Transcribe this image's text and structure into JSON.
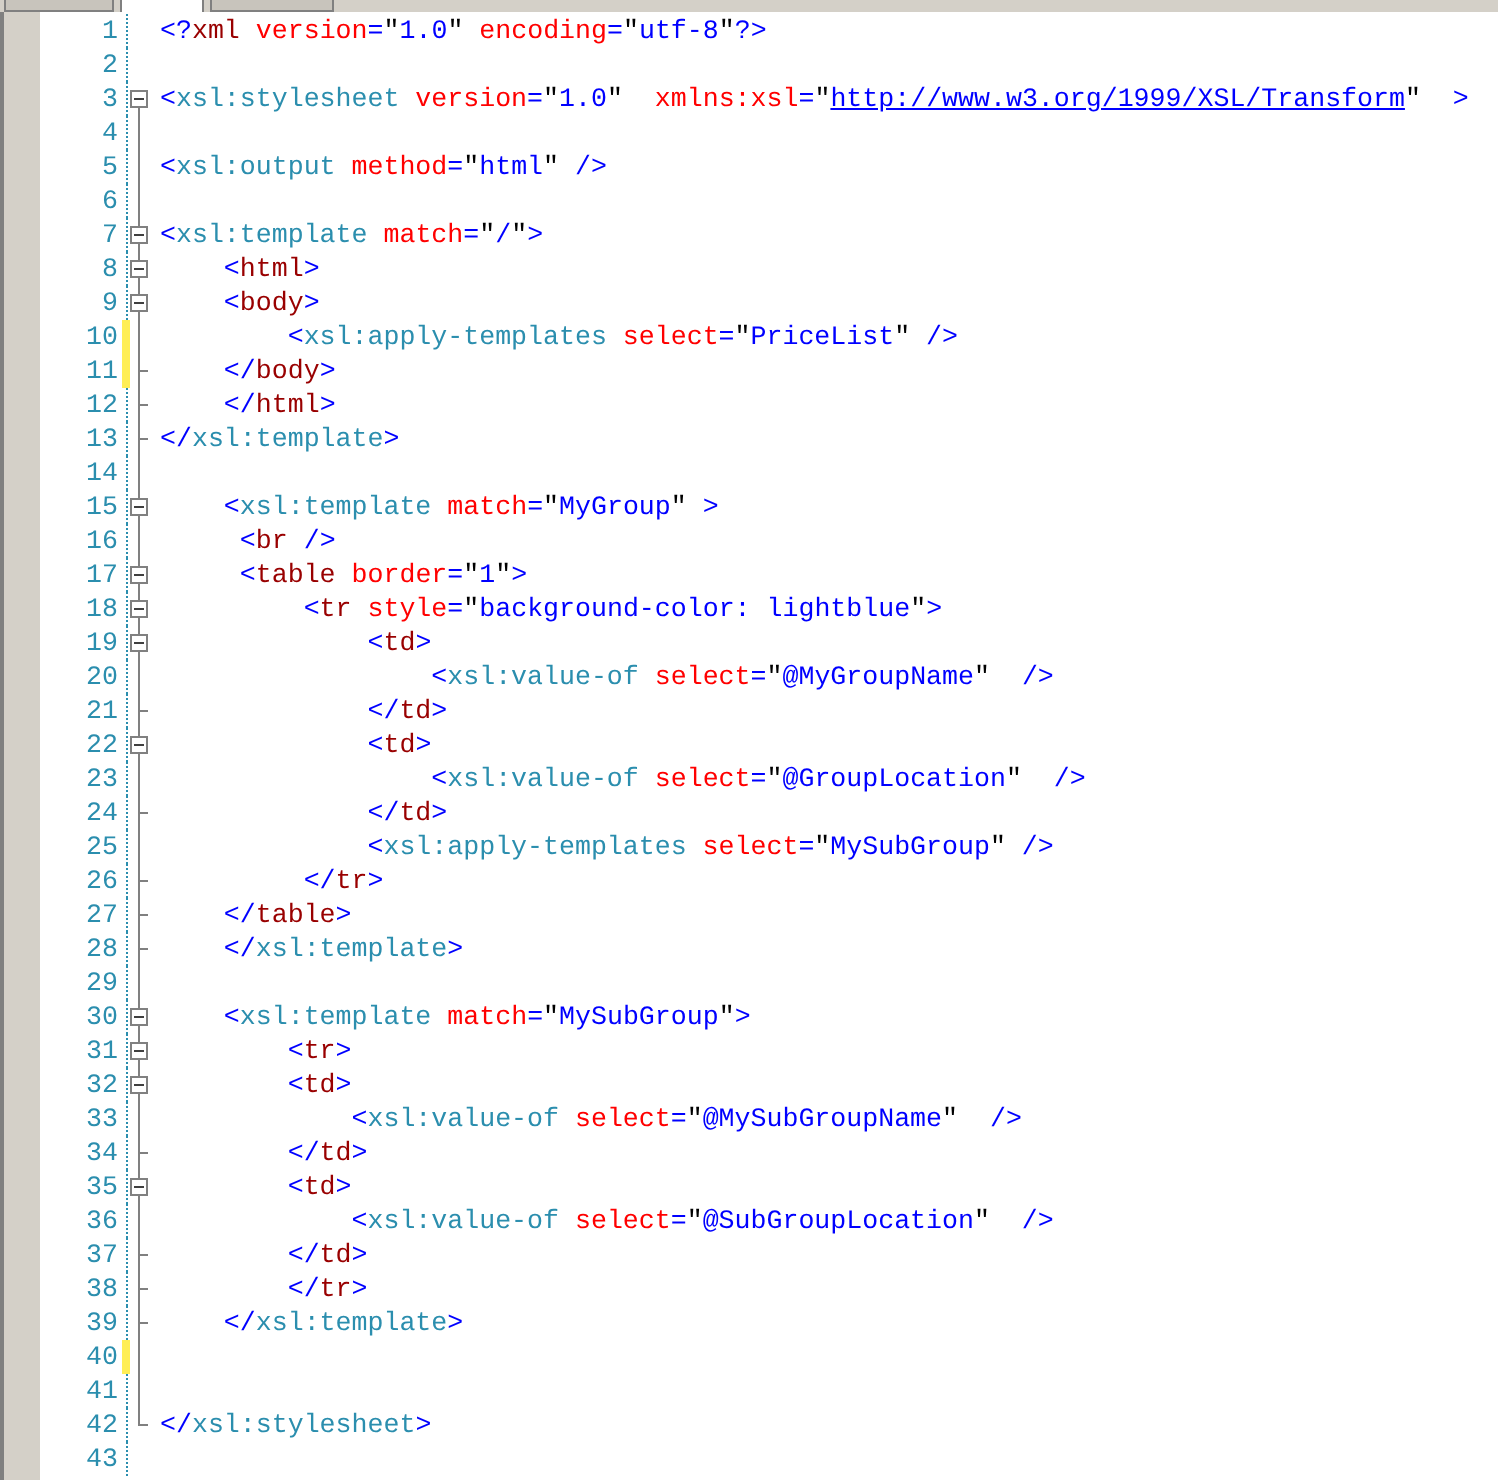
{
  "tabs": [
    {
      "selected": false
    },
    {
      "selected": true
    },
    {
      "selected": false
    }
  ],
  "lines": [
    {
      "number": "1",
      "changed": false,
      "kind": "plain",
      "tokens": [
        {
          "kind": "punct",
          "text": "<?"
        },
        {
          "kind": "html-name",
          "text": "xml"
        },
        {
          "kind": "attribute",
          "text": " version"
        },
        {
          "kind": "punct",
          "text": "="
        },
        {
          "kind": "quote",
          "text": "\""
        },
        {
          "kind": "value",
          "text": "1.0"
        },
        {
          "kind": "quote",
          "text": "\""
        },
        {
          "kind": "attribute",
          "text": " encoding"
        },
        {
          "kind": "punct",
          "text": "="
        },
        {
          "kind": "quote",
          "text": "\""
        },
        {
          "kind": "value",
          "text": "utf-8"
        },
        {
          "kind": "quote",
          "text": "\""
        },
        {
          "kind": "punct",
          "text": "?>"
        }
      ]
    },
    {
      "number": "2",
      "changed": false,
      "kind": "plain"
    },
    {
      "number": "3",
      "changed": false,
      "kind": "fold-start",
      "tokens": [
        {
          "kind": "punct",
          "text": "<"
        },
        {
          "kind": "xsl-name",
          "text": "xsl:stylesheet"
        },
        {
          "kind": "attribute",
          "text": " version"
        },
        {
          "kind": "punct",
          "text": "="
        },
        {
          "kind": "quote",
          "text": "\""
        },
        {
          "kind": "value",
          "text": "1.0"
        },
        {
          "kind": "quote",
          "text": "\""
        },
        {
          "kind": "attribute",
          "text": "  xmlns:xsl"
        },
        {
          "kind": "punct",
          "text": "="
        },
        {
          "kind": "quote",
          "text": "\""
        },
        {
          "kind": "url",
          "text": "http://www.w3.org/1999/XSL/Transform"
        },
        {
          "kind": "quote",
          "text": "\""
        },
        {
          "kind": "punct",
          "text": "  >"
        }
      ]
    },
    {
      "number": "4",
      "changed": false,
      "kind": "plain"
    },
    {
      "number": "5",
      "changed": false,
      "kind": "plain",
      "tokens": [
        {
          "kind": "punct",
          "text": "<"
        },
        {
          "kind": "xsl-name",
          "text": "xsl:output"
        },
        {
          "kind": "attribute",
          "text": " method"
        },
        {
          "kind": "punct",
          "text": "="
        },
        {
          "kind": "quote",
          "text": "\""
        },
        {
          "kind": "value",
          "text": "html"
        },
        {
          "kind": "quote",
          "text": "\""
        },
        {
          "kind": "punct",
          "text": " />"
        }
      ]
    },
    {
      "number": "6",
      "changed": false,
      "kind": "plain"
    },
    {
      "number": "7",
      "changed": false,
      "kind": "fold-start",
      "tokens": [
        {
          "kind": "punct",
          "text": "<"
        },
        {
          "kind": "xsl-name",
          "text": "xsl:template"
        },
        {
          "kind": "attribute",
          "text": " match"
        },
        {
          "kind": "punct",
          "text": "="
        },
        {
          "kind": "quote",
          "text": "\""
        },
        {
          "kind": "value",
          "text": "/"
        },
        {
          "kind": "quote",
          "text": "\""
        },
        {
          "kind": "punct",
          "text": ">"
        }
      ]
    },
    {
      "number": "8",
      "changed": false,
      "kind": "fold-start",
      "tokens": [
        {
          "kind": "punct",
          "text": "    <"
        },
        {
          "kind": "html-name",
          "text": "html"
        },
        {
          "kind": "punct",
          "text": ">"
        }
      ]
    },
    {
      "number": "9",
      "changed": false,
      "kind": "fold-start",
      "tokens": [
        {
          "kind": "punct",
          "text": "    <"
        },
        {
          "kind": "html-name",
          "text": "body"
        },
        {
          "kind": "punct",
          "text": ">"
        }
      ]
    },
    {
      "number": "10",
      "changed": true,
      "kind": "plain",
      "tokens": [
        {
          "kind": "punct",
          "text": "        <"
        },
        {
          "kind": "xsl-name",
          "text": "xsl:apply-templates"
        },
        {
          "kind": "attribute",
          "text": " select"
        },
        {
          "kind": "punct",
          "text": "="
        },
        {
          "kind": "quote",
          "text": "\""
        },
        {
          "kind": "value",
          "text": "PriceList"
        },
        {
          "kind": "quote",
          "text": "\""
        },
        {
          "kind": "punct",
          "text": " />"
        }
      ]
    },
    {
      "number": "11",
      "changed": true,
      "kind": "fold-end",
      "tokens": [
        {
          "kind": "punct",
          "text": "    </"
        },
        {
          "kind": "html-name",
          "text": "body"
        },
        {
          "kind": "punct",
          "text": ">"
        }
      ]
    },
    {
      "number": "12",
      "changed": false,
      "kind": "fold-end",
      "tokens": [
        {
          "kind": "punct",
          "text": "    </"
        },
        {
          "kind": "html-name",
          "text": "html"
        },
        {
          "kind": "punct",
          "text": ">"
        }
      ]
    },
    {
      "number": "13",
      "changed": false,
      "kind": "fold-end",
      "tokens": [
        {
          "kind": "punct",
          "text": "</"
        },
        {
          "kind": "xsl-name",
          "text": "xsl:template"
        },
        {
          "kind": "punct",
          "text": ">"
        }
      ]
    },
    {
      "number": "14",
      "changed": false,
      "kind": "plain"
    },
    {
      "number": "15",
      "changed": false,
      "kind": "fold-start",
      "tokens": [
        {
          "kind": "punct",
          "text": "    <"
        },
        {
          "kind": "xsl-name",
          "text": "xsl:template"
        },
        {
          "kind": "attribute",
          "text": " match"
        },
        {
          "kind": "punct",
          "text": "="
        },
        {
          "kind": "quote",
          "text": "\""
        },
        {
          "kind": "value",
          "text": "MyGroup"
        },
        {
          "kind": "quote",
          "text": "\""
        },
        {
          "kind": "punct",
          "text": " >"
        }
      ]
    },
    {
      "number": "16",
      "changed": false,
      "kind": "plain",
      "tokens": [
        {
          "kind": "punct",
          "text": "     <"
        },
        {
          "kind": "html-name",
          "text": "br"
        },
        {
          "kind": "punct",
          "text": " />"
        }
      ]
    },
    {
      "number": "17",
      "changed": false,
      "kind": "fold-start",
      "tokens": [
        {
          "kind": "punct",
          "text": "     <"
        },
        {
          "kind": "html-name",
          "text": "table"
        },
        {
          "kind": "attribute",
          "text": " border"
        },
        {
          "kind": "punct",
          "text": "="
        },
        {
          "kind": "quote",
          "text": "\""
        },
        {
          "kind": "value",
          "text": "1"
        },
        {
          "kind": "quote",
          "text": "\""
        },
        {
          "kind": "punct",
          "text": ">"
        }
      ]
    },
    {
      "number": "18",
      "changed": false,
      "kind": "fold-start",
      "tokens": [
        {
          "kind": "punct",
          "text": "         <"
        },
        {
          "kind": "html-name",
          "text": "tr"
        },
        {
          "kind": "attribute",
          "text": " style"
        },
        {
          "kind": "punct",
          "text": "="
        },
        {
          "kind": "quote",
          "text": "\""
        },
        {
          "kind": "value",
          "text": "background-color: lightblue"
        },
        {
          "kind": "quote",
          "text": "\""
        },
        {
          "kind": "punct",
          "text": ">"
        }
      ]
    },
    {
      "number": "19",
      "changed": false,
      "kind": "fold-start",
      "tokens": [
        {
          "kind": "punct",
          "text": "             <"
        },
        {
          "kind": "html-name",
          "text": "td"
        },
        {
          "kind": "punct",
          "text": ">"
        }
      ]
    },
    {
      "number": "20",
      "changed": false,
      "kind": "plain",
      "tokens": [
        {
          "kind": "punct",
          "text": "                 <"
        },
        {
          "kind": "xsl-name",
          "text": "xsl:value-of"
        },
        {
          "kind": "attribute",
          "text": " select"
        },
        {
          "kind": "punct",
          "text": "="
        },
        {
          "kind": "quote",
          "text": "\""
        },
        {
          "kind": "value",
          "text": "@MyGroupName"
        },
        {
          "kind": "quote",
          "text": "\""
        },
        {
          "kind": "punct",
          "text": "  />"
        }
      ]
    },
    {
      "number": "21",
      "changed": false,
      "kind": "fold-end",
      "tokens": [
        {
          "kind": "punct",
          "text": "             </"
        },
        {
          "kind": "html-name",
          "text": "td"
        },
        {
          "kind": "punct",
          "text": ">"
        }
      ]
    },
    {
      "number": "22",
      "changed": false,
      "kind": "fold-start",
      "tokens": [
        {
          "kind": "punct",
          "text": "             <"
        },
        {
          "kind": "html-name",
          "text": "td"
        },
        {
          "kind": "punct",
          "text": ">"
        }
      ]
    },
    {
      "number": "23",
      "changed": false,
      "kind": "plain",
      "tokens": [
        {
          "kind": "punct",
          "text": "                 <"
        },
        {
          "kind": "xsl-name",
          "text": "xsl:value-of"
        },
        {
          "kind": "attribute",
          "text": " select"
        },
        {
          "kind": "punct",
          "text": "="
        },
        {
          "kind": "quote",
          "text": "\""
        },
        {
          "kind": "value",
          "text": "@GroupLocation"
        },
        {
          "kind": "quote",
          "text": "\""
        },
        {
          "kind": "punct",
          "text": "  />"
        }
      ]
    },
    {
      "number": "24",
      "changed": false,
      "kind": "fold-end",
      "tokens": [
        {
          "kind": "punct",
          "text": "             </"
        },
        {
          "kind": "html-name",
          "text": "td"
        },
        {
          "kind": "punct",
          "text": ">"
        }
      ]
    },
    {
      "number": "25",
      "changed": false,
      "kind": "plain",
      "tokens": [
        {
          "kind": "punct",
          "text": "             <"
        },
        {
          "kind": "xsl-name",
          "text": "xsl:apply-templates"
        },
        {
          "kind": "attribute",
          "text": " select"
        },
        {
          "kind": "punct",
          "text": "="
        },
        {
          "kind": "quote",
          "text": "\""
        },
        {
          "kind": "value",
          "text": "MySubGroup"
        },
        {
          "kind": "quote",
          "text": "\""
        },
        {
          "kind": "punct",
          "text": " />"
        }
      ]
    },
    {
      "number": "26",
      "changed": false,
      "kind": "fold-end",
      "tokens": [
        {
          "kind": "punct",
          "text": "         </"
        },
        {
          "kind": "html-name",
          "text": "tr"
        },
        {
          "kind": "punct",
          "text": ">"
        }
      ]
    },
    {
      "number": "27",
      "changed": false,
      "kind": "fold-end",
      "tokens": [
        {
          "kind": "punct",
          "text": "    </"
        },
        {
          "kind": "html-name",
          "text": "table"
        },
        {
          "kind": "punct",
          "text": ">"
        }
      ]
    },
    {
      "number": "28",
      "changed": false,
      "kind": "fold-end",
      "tokens": [
        {
          "kind": "punct",
          "text": "    </"
        },
        {
          "kind": "xsl-name",
          "text": "xsl:template"
        },
        {
          "kind": "punct",
          "text": ">"
        }
      ]
    },
    {
      "number": "29",
      "changed": false,
      "kind": "plain"
    },
    {
      "number": "30",
      "changed": false,
      "kind": "fold-start",
      "tokens": [
        {
          "kind": "punct",
          "text": "    <"
        },
        {
          "kind": "xsl-name",
          "text": "xsl:template"
        },
        {
          "kind": "attribute",
          "text": " match"
        },
        {
          "kind": "punct",
          "text": "="
        },
        {
          "kind": "quote",
          "text": "\""
        },
        {
          "kind": "value",
          "text": "MySubGroup"
        },
        {
          "kind": "quote",
          "text": "\""
        },
        {
          "kind": "punct",
          "text": ">"
        }
      ]
    },
    {
      "number": "31",
      "changed": false,
      "kind": "fold-start",
      "tokens": [
        {
          "kind": "punct",
          "text": "        <"
        },
        {
          "kind": "html-name",
          "text": "tr"
        },
        {
          "kind": "punct",
          "text": ">"
        }
      ]
    },
    {
      "number": "32",
      "changed": false,
      "kind": "fold-start",
      "tokens": [
        {
          "kind": "punct",
          "text": "        <"
        },
        {
          "kind": "html-name",
          "text": "td"
        },
        {
          "kind": "punct",
          "text": ">"
        }
      ]
    },
    {
      "number": "33",
      "changed": false,
      "kind": "plain",
      "tokens": [
        {
          "kind": "punct",
          "text": "            <"
        },
        {
          "kind": "xsl-name",
          "text": "xsl:value-of"
        },
        {
          "kind": "attribute",
          "text": " select"
        },
        {
          "kind": "punct",
          "text": "="
        },
        {
          "kind": "quote",
          "text": "\""
        },
        {
          "kind": "value",
          "text": "@MySubGroupName"
        },
        {
          "kind": "quote",
          "text": "\""
        },
        {
          "kind": "punct",
          "text": "  />"
        }
      ]
    },
    {
      "number": "34",
      "changed": false,
      "kind": "fold-end",
      "tokens": [
        {
          "kind": "punct",
          "text": "        </"
        },
        {
          "kind": "html-name",
          "text": "td"
        },
        {
          "kind": "punct",
          "text": ">"
        }
      ]
    },
    {
      "number": "35",
      "changed": false,
      "kind": "fold-start",
      "tokens": [
        {
          "kind": "punct",
          "text": "        <"
        },
        {
          "kind": "html-name",
          "text": "td"
        },
        {
          "kind": "punct",
          "text": ">"
        }
      ]
    },
    {
      "number": "36",
      "changed": false,
      "kind": "plain",
      "tokens": [
        {
          "kind": "punct",
          "text": "            <"
        },
        {
          "kind": "xsl-name",
          "text": "xsl:value-of"
        },
        {
          "kind": "attribute",
          "text": " select"
        },
        {
          "kind": "punct",
          "text": "="
        },
        {
          "kind": "quote",
          "text": "\""
        },
        {
          "kind": "value",
          "text": "@SubGroupLocation"
        },
        {
          "kind": "quote",
          "text": "\""
        },
        {
          "kind": "punct",
          "text": "  />"
        }
      ]
    },
    {
      "number": "37",
      "changed": false,
      "kind": "fold-end",
      "tokens": [
        {
          "kind": "punct",
          "text": "        </"
        },
        {
          "kind": "html-name",
          "text": "td"
        },
        {
          "kind": "punct",
          "text": ">"
        }
      ]
    },
    {
      "number": "38",
      "changed": false,
      "kind": "fold-end",
      "tokens": [
        {
          "kind": "punct",
          "text": "        </"
        },
        {
          "kind": "html-name",
          "text": "tr"
        },
        {
          "kind": "punct",
          "text": ">"
        }
      ]
    },
    {
      "number": "39",
      "changed": false,
      "kind": "fold-end",
      "tokens": [
        {
          "kind": "punct",
          "text": "    </"
        },
        {
          "kind": "xsl-name",
          "text": "xsl:template"
        },
        {
          "kind": "punct",
          "text": ">"
        }
      ]
    },
    {
      "number": "40",
      "changed": true,
      "kind": "plain"
    },
    {
      "number": "41",
      "changed": false,
      "kind": "plain"
    },
    {
      "number": "42",
      "changed": false,
      "kind": "fold-last",
      "tokens": [
        {
          "kind": "punct",
          "text": "</"
        },
        {
          "kind": "xsl-name",
          "text": "xsl:stylesheet"
        },
        {
          "kind": "punct",
          "text": ">"
        }
      ]
    },
    {
      "number": "43",
      "changed": false,
      "kind": "plain"
    }
  ]
}
